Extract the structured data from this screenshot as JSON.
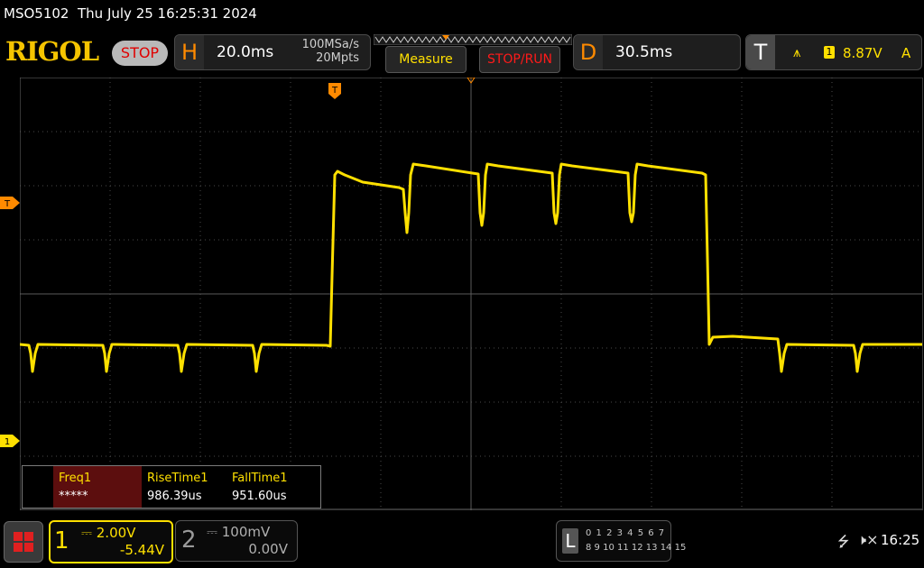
{
  "title_bar": {
    "model": "MSO5102",
    "datetime": "Thu July 25 16:25:31 2024"
  },
  "header": {
    "brand": "RIGOL",
    "run_state": "STOP",
    "horizontal": {
      "letter": "H",
      "timebase": "20.0ms",
      "sample_rate": "100MSa/s",
      "memory_depth": "20Mpts"
    },
    "buttons": {
      "measure": "Measure",
      "stop_run": "STOP/RUN"
    },
    "delay": {
      "letter": "D",
      "value": "30.5ms"
    },
    "trigger": {
      "letter": "T",
      "source": "1",
      "level": "8.87V",
      "mode": "A"
    }
  },
  "screen": {
    "trigger_position_label": "T",
    "trigger_level_label": "T",
    "ch1_offset_label": "1"
  },
  "measurements": [
    {
      "name": "Freq1",
      "value": "*****"
    },
    {
      "name": "RiseTime1",
      "value": "986.39us"
    },
    {
      "name": "FallTime1",
      "value": "951.60us"
    }
  ],
  "channels": [
    {
      "number": "1",
      "scale": "2.00V",
      "offset": "-5.44V",
      "active": true
    },
    {
      "number": "2",
      "scale": "100mV",
      "offset": "0.00V",
      "active": false
    }
  ],
  "logic": {
    "letter": "L",
    "row1": "0 1 2 3  4 5 6 7",
    "row2": "8 9 10 11 12 13 14 15"
  },
  "status": {
    "clock": "16:25"
  },
  "colors": {
    "ch1": "#ffe000",
    "trigger": "#ff8a00",
    "stop": "#e00000",
    "grid": "#4a4a4a"
  }
}
